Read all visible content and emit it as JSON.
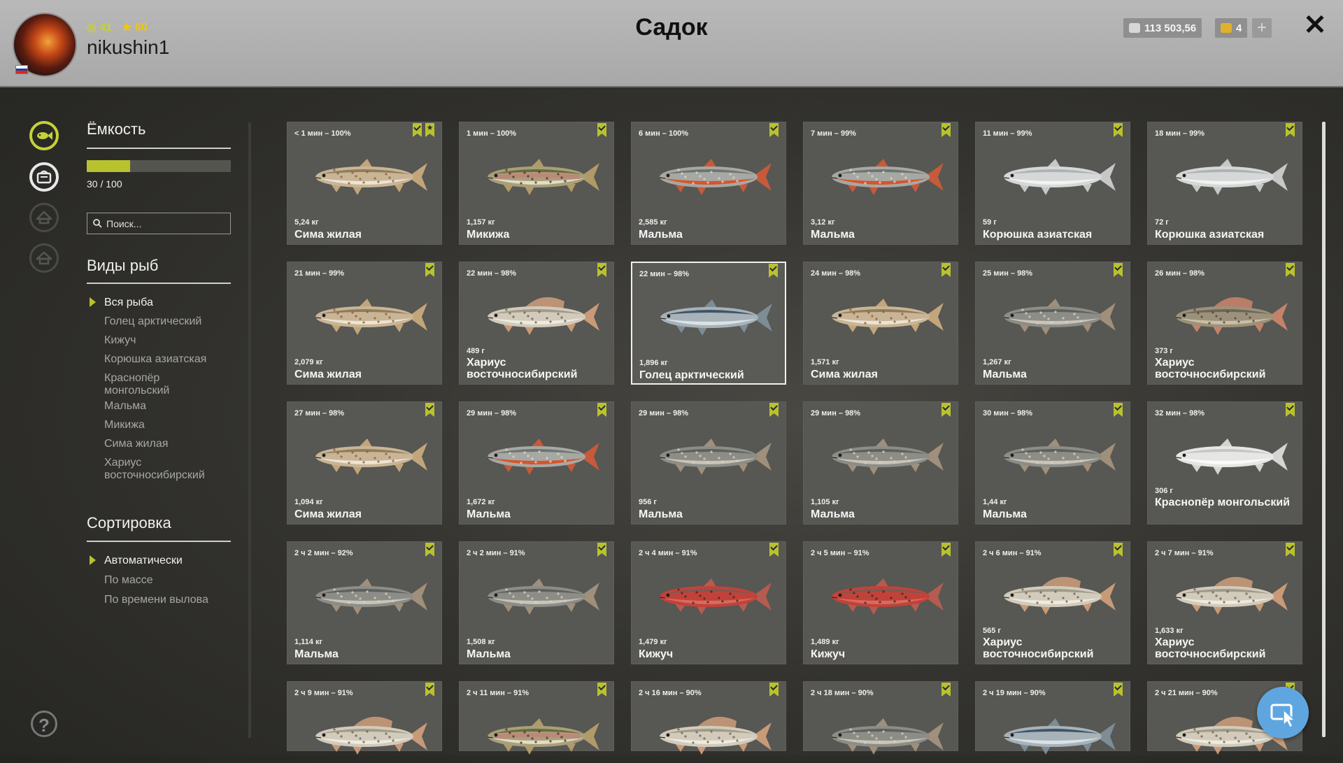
{
  "header": {
    "title": "Садок",
    "username": "nikushin1",
    "level": "41",
    "rank": "60",
    "silver": "113 503,56",
    "gold": "4",
    "plus": "+",
    "close": "✕"
  },
  "sidebar": {
    "capacity_title": "Ёмкость",
    "capacity_text": "30 / 100",
    "capacity_fraction": 0.3,
    "search_placeholder": "Поиск...",
    "species_title": "Виды рыб",
    "species": [
      "Вся рыба",
      "Голец арктический",
      "Кижуч",
      "Корюшка азиатская",
      "Краснопёр монгольский",
      "Мальма",
      "Микижа",
      "Сима жилая",
      "Хариус восточносибирский"
    ],
    "sort_title": "Сортировка",
    "sort": [
      "Автоматически",
      "По массе",
      "По времени вылова"
    ],
    "help": "?"
  },
  "catch": [
    {
      "time": "< 1 мин – 100%",
      "weight": "5,24 кг",
      "name": "Сима жилая",
      "fish": "trout-spotted",
      "star": true
    },
    {
      "time": "1 мин – 100%",
      "weight": "1,157 кг",
      "name": "Микижа",
      "fish": "rainbow"
    },
    {
      "time": "6 мин – 100%",
      "weight": "2,585 кг",
      "name": "Мальма",
      "fish": "char-red"
    },
    {
      "time": "7 мин – 99%",
      "weight": "3,12 кг",
      "name": "Мальма",
      "fish": "char-red"
    },
    {
      "time": "11 мин – 99%",
      "weight": "59 г",
      "name": "Корюшка азиатская",
      "fish": "smelt"
    },
    {
      "time": "18 мин – 99%",
      "weight": "72 г",
      "name": "Корюшка азиатская",
      "fish": "smelt"
    },
    {
      "time": "21 мин – 99%",
      "weight": "2,079 кг",
      "name": "Сима жилая",
      "fish": "trout-spotted"
    },
    {
      "time": "22 мин – 98%",
      "weight": "489 г",
      "name": "Хариус восточносибирский",
      "fish": "grayling"
    },
    {
      "time": "22 мин – 98%",
      "weight": "1,896 кг",
      "name": "Голец арктический",
      "fish": "arctic-char",
      "selected": true
    },
    {
      "time": "24 мин – 98%",
      "weight": "1,571 кг",
      "name": "Сима жилая",
      "fish": "trout-spotted"
    },
    {
      "time": "25 мин – 98%",
      "weight": "1,267 кг",
      "name": "Мальма",
      "fish": "char-grey"
    },
    {
      "time": "26 мин – 98%",
      "weight": "373 г",
      "name": "Хариус восточносибирский",
      "fish": "grayling-dark"
    },
    {
      "time": "27 мин – 98%",
      "weight": "1,094 кг",
      "name": "Сима жилая",
      "fish": "trout-spotted"
    },
    {
      "time": "29 мин – 98%",
      "weight": "1,672 кг",
      "name": "Мальма",
      "fish": "char-red"
    },
    {
      "time": "29 мин – 98%",
      "weight": "956 г",
      "name": "Мальма",
      "fish": "char-grey"
    },
    {
      "time": "29 мин – 98%",
      "weight": "1,105 кг",
      "name": "Мальма",
      "fish": "char-grey"
    },
    {
      "time": "30 мин – 98%",
      "weight": "1,44 кг",
      "name": "Мальма",
      "fish": "char-grey"
    },
    {
      "time": "32 мин – 98%",
      "weight": "306 г",
      "name": "Краснопёр монгольский",
      "fish": "redfin"
    },
    {
      "time": "2 ч 2 мин – 92%",
      "weight": "1,114 кг",
      "name": "Мальма",
      "fish": "char-grey"
    },
    {
      "time": "2 ч 2 мин – 91%",
      "weight": "1,508 кг",
      "name": "Мальма",
      "fish": "char-grey"
    },
    {
      "time": "2 ч 4 мин – 91%",
      "weight": "1,479 кг",
      "name": "Кижуч",
      "fish": "coho"
    },
    {
      "time": "2 ч 5 мин – 91%",
      "weight": "1,489 кг",
      "name": "Кижуч",
      "fish": "coho"
    },
    {
      "time": "2 ч 6 мин – 91%",
      "weight": "565 г",
      "name": "Хариус восточносибирский",
      "fish": "grayling"
    },
    {
      "time": "2 ч 7 мин – 91%",
      "weight": "1,633 кг",
      "name": "Хариус восточносибирский",
      "fish": "grayling"
    },
    {
      "time": "2 ч 9 мин – 91%",
      "weight": "",
      "name": "",
      "fish": "grayling"
    },
    {
      "time": "2 ч 11 мин – 91%",
      "weight": "",
      "name": "",
      "fish": "rainbow"
    },
    {
      "time": "2 ч 16 мин – 90%",
      "weight": "",
      "name": "",
      "fish": "grayling"
    },
    {
      "time": "2 ч 18 мин – 90%",
      "weight": "",
      "name": "",
      "fish": "char-grey"
    },
    {
      "time": "2 ч 19 мин – 90%",
      "weight": "",
      "name": "",
      "fish": "arctic-char"
    },
    {
      "time": "2 ч 21 мин – 90%",
      "weight": "",
      "name": "",
      "fish": "grayling"
    }
  ],
  "colors": {
    "accent": "#b8c22f",
    "fab": "#5fa6e0"
  }
}
